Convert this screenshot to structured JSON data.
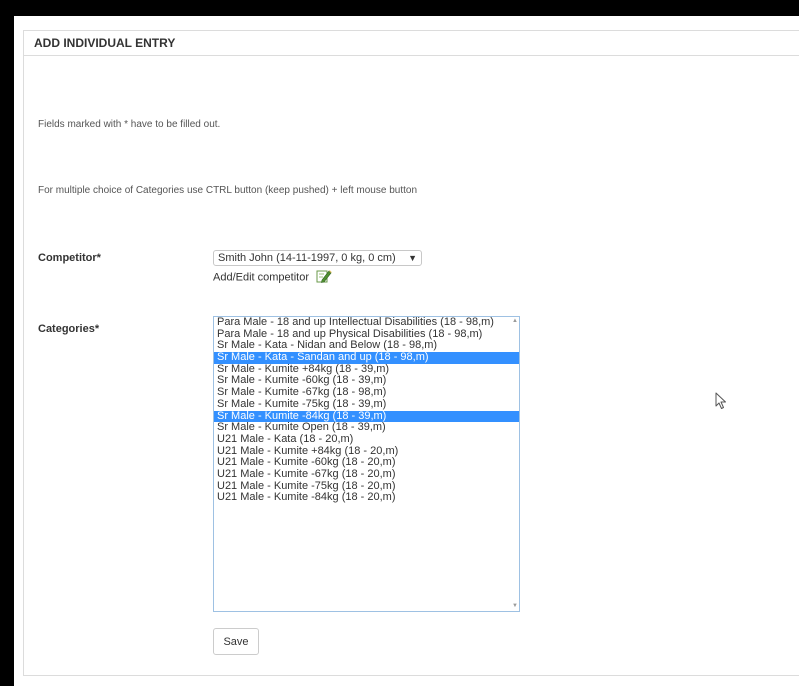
{
  "panel": {
    "title": "ADD INDIVIDUAL ENTRY"
  },
  "notes": {
    "required": "Fields marked with * have to be filled out.",
    "multiselect": "For multiple choice of Categories use CTRL button (keep pushed) + left mouse button"
  },
  "competitor": {
    "label": "Competitor*",
    "selected": "Smith John (14-11-1997, 0 kg, 0 cm)",
    "arrow": "▼",
    "add_edit_label": "Add/Edit competitor",
    "add_edit_icon": "edit-pencil-icon"
  },
  "categories": {
    "label": "Categories*",
    "options": [
      {
        "label": "Para Male - 18 and up Intellectual Disabilities (18 - 98,m)",
        "selected": false
      },
      {
        "label": "Para Male - 18 and up Physical Disabilities (18 - 98,m)",
        "selected": false
      },
      {
        "label": "Sr Male - Kata - Nidan and Below (18 - 98,m)",
        "selected": false
      },
      {
        "label": "Sr Male - Kata - Sandan and up (18 - 98,m)",
        "selected": true
      },
      {
        "label": "Sr Male - Kumite +84kg (18 - 39,m)",
        "selected": false
      },
      {
        "label": "Sr Male - Kumite -60kg (18 - 39,m)",
        "selected": false
      },
      {
        "label": "Sr Male - Kumite -67kg (18 - 98,m)",
        "selected": false
      },
      {
        "label": "Sr Male - Kumite -75kg (18 - 39,m)",
        "selected": false
      },
      {
        "label": "Sr Male - Kumite -84kg (18 - 39,m)",
        "selected": true
      },
      {
        "label": "Sr Male - Kumite Open (18 - 39,m)",
        "selected": false
      },
      {
        "label": "U21 Male - Kata (18 - 20,m)",
        "selected": false
      },
      {
        "label": "U21 Male - Kumite +84kg (18 - 20,m)",
        "selected": false
      },
      {
        "label": "U21 Male - Kumite -60kg (18 - 20,m)",
        "selected": false
      },
      {
        "label": "U21 Male - Kumite -67kg (18 - 20,m)",
        "selected": false
      },
      {
        "label": "U21 Male - Kumite -75kg (18 - 20,m)",
        "selected": false
      },
      {
        "label": "U21 Male - Kumite -84kg (18 - 20,m)",
        "selected": false
      }
    ],
    "scroll_up": "▲",
    "scroll_down": "▼"
  },
  "actions": {
    "save_label": "Save"
  },
  "colors": {
    "selected_bg": "#3390ff",
    "list_border": "#9ec1e3",
    "panel_border": "#dcdcdc"
  }
}
